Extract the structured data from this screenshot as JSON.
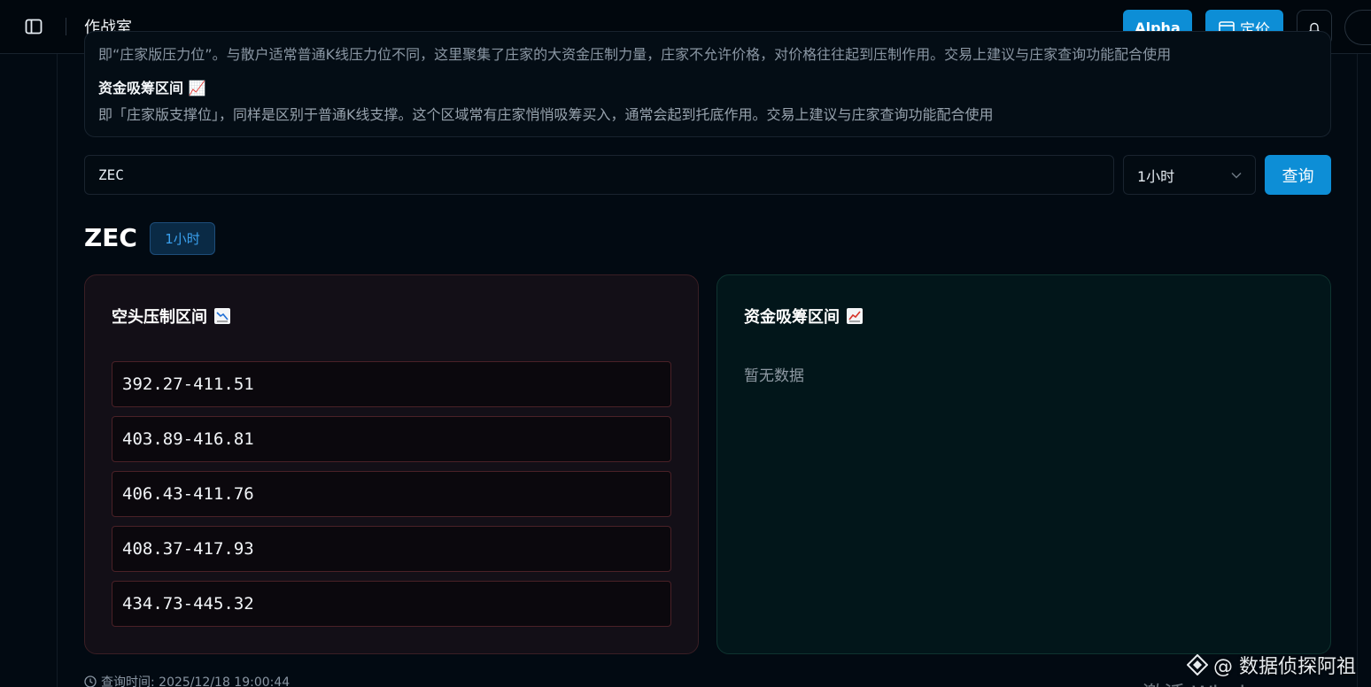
{
  "topbar": {
    "title": "作战室",
    "alpha_label": "Alpha",
    "pricing_label": "定价"
  },
  "info": {
    "clipped_line": "即“庄家版压力位”。与散户适常普通K线压力位不同，这里聚集了庄家的大资金压制力量，庄家不允许价格，对价格往往起到压制作用。交易上建议与庄家查询功能配合使用",
    "heading": "资金吸筹区间 📈",
    "description": "即「庄家版支撑位」，同样是区别于普通K线支撑。这个区域常有庄家悄悄吸筹买入，通常会起到托底作用。交易上建议与庄家查询功能配合使用"
  },
  "query": {
    "symbol_value": "ZEC",
    "interval_value": "1小时",
    "submit_label": "查询"
  },
  "result": {
    "symbol": "ZEC",
    "interval_badge": "1小时",
    "resistance": {
      "title": "空头压制区间",
      "ranges": [
        "392.27-411.51",
        "403.89-416.81",
        "406.43-411.76",
        "408.37-417.93",
        "434.73-445.32"
      ]
    },
    "support": {
      "title": "资金吸筹区间",
      "empty_text": "暂无数据"
    },
    "query_time": "查询时间: 2025/12/18 19:00:44"
  },
  "overlay": {
    "watermark": "@ 数据侦探阿祖",
    "activate_text": "激活 Windows"
  },
  "colors": {
    "accent": "#0d8ed6",
    "resistance_border": "#4a2127",
    "support_bg": "#02161a"
  }
}
